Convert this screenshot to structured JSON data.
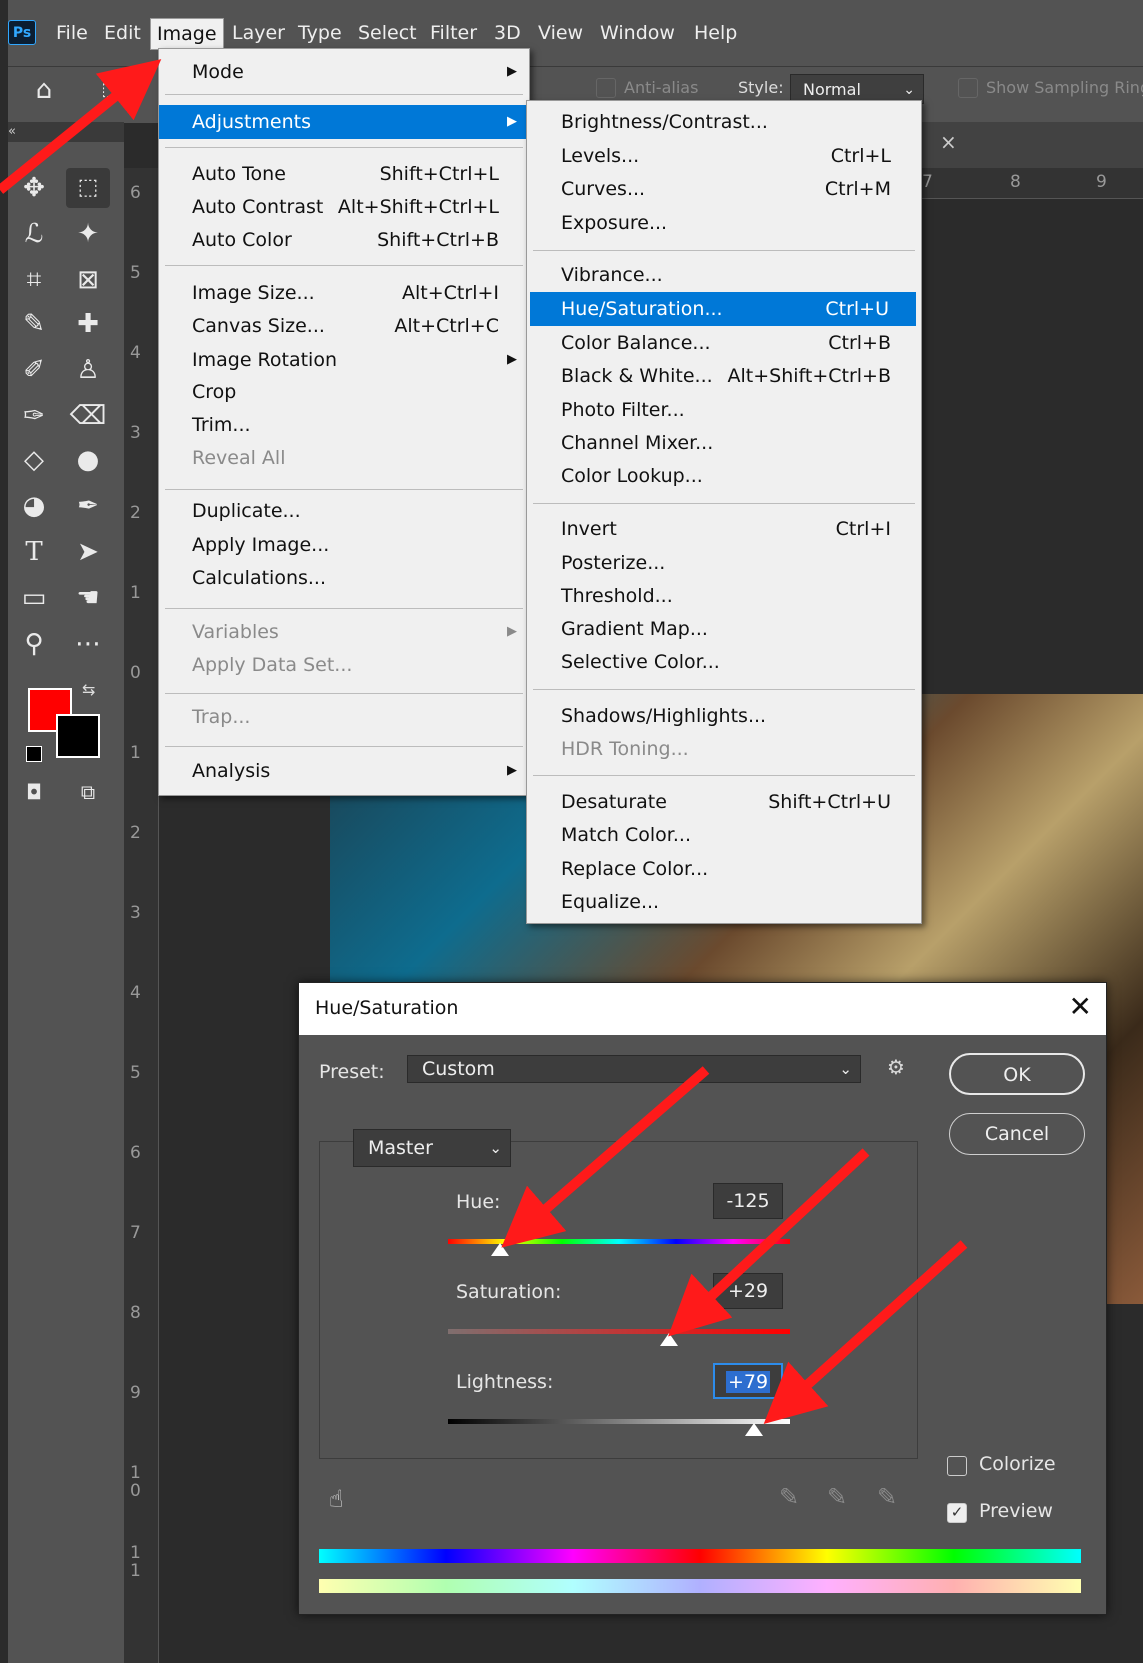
{
  "app": {
    "logo": "Ps"
  },
  "menubar": {
    "items": [
      "File",
      "Edit",
      "Image",
      "Layer",
      "Type",
      "Select",
      "Filter",
      "3D",
      "View",
      "Window",
      "Help"
    ],
    "active": "Image"
  },
  "options_bar": {
    "anti_alias": "Anti-alias",
    "style_label": "Style:",
    "style_value": "Normal",
    "sampling": "Show Sampling Ring"
  },
  "ruler": {
    "top": [
      "7",
      "8",
      "9"
    ],
    "left": [
      "6",
      "5",
      "4",
      "3",
      "2",
      "1",
      "0",
      "1",
      "2",
      "3",
      "4",
      "5",
      "6",
      "7",
      "8",
      "9",
      "1\n0",
      "1\n1"
    ]
  },
  "image_menu": {
    "items": [
      {
        "label": "Mode",
        "shortcut": "",
        "submenu": true,
        "disabled": false
      },
      {
        "label": "Adjustments",
        "shortcut": "",
        "submenu": true,
        "disabled": false,
        "highlighted": true
      },
      {
        "label": "Auto Tone",
        "shortcut": "Shift+Ctrl+L"
      },
      {
        "label": "Auto Contrast",
        "shortcut": "Alt+Shift+Ctrl+L"
      },
      {
        "label": "Auto Color",
        "shortcut": "Shift+Ctrl+B"
      },
      {
        "label": "Image Size...",
        "shortcut": "Alt+Ctrl+I"
      },
      {
        "label": "Canvas Size...",
        "shortcut": "Alt+Ctrl+C"
      },
      {
        "label": "Image Rotation",
        "shortcut": "",
        "submenu": true
      },
      {
        "label": "Crop",
        "shortcut": ""
      },
      {
        "label": "Trim...",
        "shortcut": ""
      },
      {
        "label": "Reveal All",
        "shortcut": "",
        "disabled": true
      },
      {
        "label": "Duplicate...",
        "shortcut": ""
      },
      {
        "label": "Apply Image...",
        "shortcut": ""
      },
      {
        "label": "Calculations...",
        "shortcut": ""
      },
      {
        "label": "Variables",
        "shortcut": "",
        "submenu": true,
        "disabled": true
      },
      {
        "label": "Apply Data Set...",
        "shortcut": "",
        "disabled": true
      },
      {
        "label": "Trap...",
        "shortcut": "",
        "disabled": true
      },
      {
        "label": "Analysis",
        "shortcut": "",
        "submenu": true
      }
    ]
  },
  "adjustments_menu": {
    "items": [
      {
        "label": "Brightness/Contrast...",
        "shortcut": ""
      },
      {
        "label": "Levels...",
        "shortcut": "Ctrl+L"
      },
      {
        "label": "Curves...",
        "shortcut": "Ctrl+M"
      },
      {
        "label": "Exposure...",
        "shortcut": ""
      },
      {
        "label": "Vibrance...",
        "shortcut": ""
      },
      {
        "label": "Hue/Saturation...",
        "shortcut": "Ctrl+U",
        "highlighted": true
      },
      {
        "label": "Color Balance...",
        "shortcut": "Ctrl+B"
      },
      {
        "label": "Black & White...",
        "shortcut": "Alt+Shift+Ctrl+B"
      },
      {
        "label": "Photo Filter...",
        "shortcut": ""
      },
      {
        "label": "Channel Mixer...",
        "shortcut": ""
      },
      {
        "label": "Color Lookup...",
        "shortcut": ""
      },
      {
        "label": "Invert",
        "shortcut": "Ctrl+I"
      },
      {
        "label": "Posterize...",
        "shortcut": ""
      },
      {
        "label": "Threshold...",
        "shortcut": ""
      },
      {
        "label": "Gradient Map...",
        "shortcut": ""
      },
      {
        "label": "Selective Color...",
        "shortcut": ""
      },
      {
        "label": "Shadows/Highlights...",
        "shortcut": ""
      },
      {
        "label": "HDR Toning...",
        "shortcut": "",
        "disabled": true
      },
      {
        "label": "Desaturate",
        "shortcut": "Shift+Ctrl+U"
      },
      {
        "label": "Match Color...",
        "shortcut": ""
      },
      {
        "label": "Replace Color...",
        "shortcut": ""
      },
      {
        "label": "Equalize...",
        "shortcut": ""
      }
    ]
  },
  "dialog": {
    "title": "Hue/Saturation",
    "preset_label": "Preset:",
    "preset_value": "Custom",
    "channel_value": "Master",
    "ok_label": "OK",
    "cancel_label": "Cancel",
    "hue_label": "Hue:",
    "hue_value": "-125",
    "hue_level": -125,
    "saturation_label": "Saturation:",
    "saturation_value": "+29",
    "saturation_level": 29,
    "lightness_label": "Lightness:",
    "lightness_value": "+79",
    "lightness_level": 79,
    "colorize_label": "Colorize",
    "colorize_checked": false,
    "preview_label": "Preview",
    "preview_checked": true
  },
  "colors": {
    "accent": "#0078d7",
    "foreground": "#ff0000",
    "background": "#000000",
    "arrow": "#ff1a1a"
  }
}
